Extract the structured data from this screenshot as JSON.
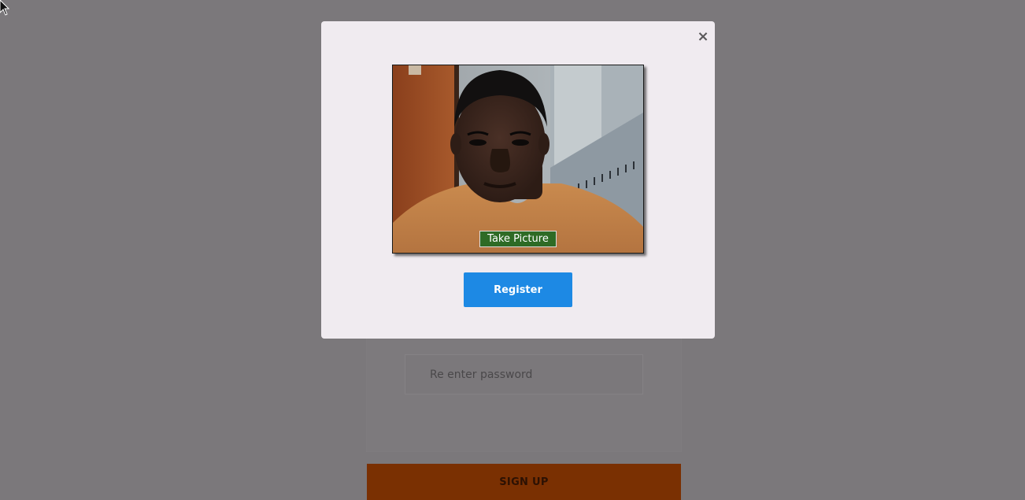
{
  "signup": {
    "password_placeholder": "Re enter password",
    "signup_label": "SIGN UP"
  },
  "modal": {
    "close_label": "×",
    "camera": {
      "take_picture_label": "Take Picture"
    },
    "register_label": "Register"
  },
  "colors": {
    "overlay": "#7b787b",
    "modal_bg": "#f0ebf0",
    "register_blue": "#1d89e4",
    "take_picture_green": "#2e6b25",
    "signup_orange_dimmed": "#7a3002"
  },
  "icons": {
    "cursor": "mouse-pointer-icon",
    "close": "close-icon"
  }
}
